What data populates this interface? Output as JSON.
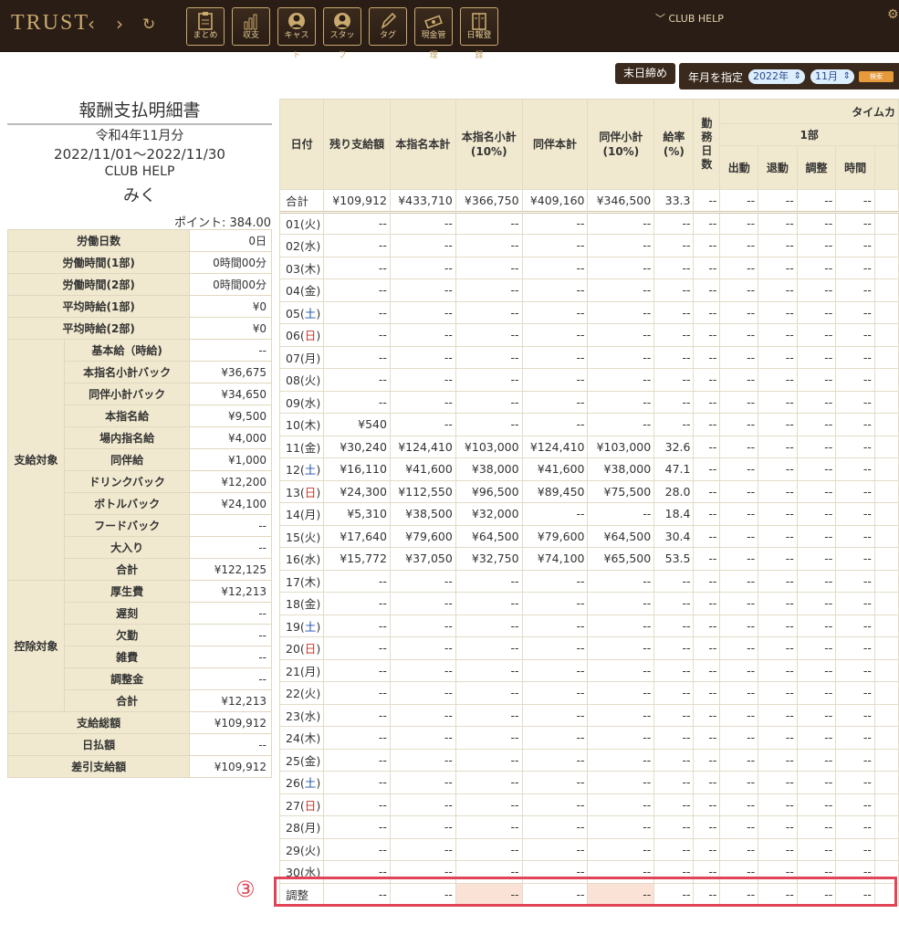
{
  "header": {
    "logo": "TRUST",
    "back": "‹",
    "forward": "›",
    "reload": "↻",
    "club": "CLUB HELP",
    "gear": "⚙",
    "tools": [
      {
        "label": "まとめ",
        "label2": ""
      },
      {
        "label": "収支",
        "label2": ""
      },
      {
        "label": "キャス",
        "label2": "ト"
      },
      {
        "label": "スタッ",
        "label2": "フ"
      },
      {
        "label": "タグ",
        "label2": ""
      },
      {
        "label": "現金管",
        "label2": "理"
      },
      {
        "label": "日報登",
        "label2": "録"
      }
    ]
  },
  "controls": {
    "end_btn": "末日締め",
    "ym_label": "年月を指定",
    "year": "2022年",
    "month": "11月",
    "search": "検索"
  },
  "slip": {
    "title": "報酬支払明細書",
    "period_jp": "令和4年11月分",
    "range": "2022/11/01〜2022/11/30",
    "club": "CLUB HELP",
    "name": "みく",
    "points": "ポイント: 384.00"
  },
  "summary": {
    "top": [
      {
        "k": "労働日数",
        "v": "0日"
      },
      {
        "k": "労働時間(1部)",
        "v": "0時間00分"
      },
      {
        "k": "労働時間(2部)",
        "v": "0時間00分"
      },
      {
        "k": "平均時給(1部)",
        "v": "¥0"
      },
      {
        "k": "平均時給(2部)",
        "v": "¥0"
      }
    ],
    "pay_group": "支給対象",
    "pay": [
      {
        "k": "基本給（時給)",
        "v": "--"
      },
      {
        "k": "本指名小計バック",
        "v": "¥36,675"
      },
      {
        "k": "同伴小計バック",
        "v": "¥34,650"
      },
      {
        "k": "本指名給",
        "v": "¥9,500"
      },
      {
        "k": "場内指名給",
        "v": "¥4,000"
      },
      {
        "k": "同伴給",
        "v": "¥1,000"
      },
      {
        "k": "ドリンクバック",
        "v": "¥12,200"
      },
      {
        "k": "ボトルバック",
        "v": "¥24,100"
      },
      {
        "k": "フードバック",
        "v": "--"
      },
      {
        "k": "大入り",
        "v": "--"
      },
      {
        "k": "合計",
        "v": "¥122,125"
      }
    ],
    "ded_group": "控除対象",
    "ded": [
      {
        "k": "厚生費",
        "v": "¥12,213"
      },
      {
        "k": "遅刻",
        "v": "--"
      },
      {
        "k": "欠勤",
        "v": "--"
      },
      {
        "k": "雑費",
        "v": "--"
      },
      {
        "k": "調整金",
        "v": "--"
      },
      {
        "k": "合計",
        "v": "¥12,213"
      }
    ],
    "bottom": [
      {
        "k": "支給総額",
        "v": "¥109,912"
      },
      {
        "k": "日払額",
        "v": "--"
      },
      {
        "k": "差引支給額",
        "v": "¥109,912"
      }
    ]
  },
  "table": {
    "headers": [
      "日付",
      "残り支給額",
      "本指名本計",
      "本指名小計\n(10%)",
      "同伴本計",
      "同伴小計\n(10%)",
      "給率\n(%)",
      "勤\n務\n日\n数"
    ],
    "timecard": "タイムカ",
    "part1": "1部",
    "sub": [
      "出動",
      "退動",
      "調整",
      "時間"
    ],
    "total": [
      "合計",
      "¥109,912",
      "¥433,710",
      "¥366,750",
      "¥409,160",
      "¥346,500",
      "33.3",
      "--",
      "--",
      "--",
      "--",
      "--",
      ""
    ],
    "rows": [
      [
        "01(火)",
        "--",
        "--",
        "--",
        "--",
        "--",
        "--",
        "--",
        "--",
        "--",
        "--",
        "--",
        ""
      ],
      [
        "02(水)",
        "--",
        "--",
        "--",
        "--",
        "--",
        "--",
        "--",
        "--",
        "--",
        "--",
        "--",
        ""
      ],
      [
        "03(木)",
        "--",
        "--",
        "--",
        "--",
        "--",
        "--",
        "--",
        "--",
        "--",
        "--",
        "--",
        ""
      ],
      [
        "04(金)",
        "--",
        "--",
        "--",
        "--",
        "--",
        "--",
        "--",
        "--",
        "--",
        "--",
        "--",
        ""
      ],
      [
        "05(土)",
        "--",
        "--",
        "--",
        "--",
        "--",
        "--",
        "--",
        "--",
        "--",
        "--",
        "--",
        ""
      ],
      [
        "06(日)",
        "--",
        "--",
        "--",
        "--",
        "--",
        "--",
        "--",
        "--",
        "--",
        "--",
        "--",
        ""
      ],
      [
        "07(月)",
        "--",
        "--",
        "--",
        "--",
        "--",
        "--",
        "--",
        "--",
        "--",
        "--",
        "--",
        ""
      ],
      [
        "08(火)",
        "--",
        "--",
        "--",
        "--",
        "--",
        "--",
        "--",
        "--",
        "--",
        "--",
        "--",
        ""
      ],
      [
        "09(水)",
        "--",
        "--",
        "--",
        "--",
        "--",
        "--",
        "--",
        "--",
        "--",
        "--",
        "--",
        ""
      ],
      [
        "10(木)",
        "¥540",
        "--",
        "--",
        "--",
        "--",
        "--",
        "--",
        "--",
        "--",
        "--",
        "--",
        ""
      ],
      [
        "11(金)",
        "¥30,240",
        "¥124,410",
        "¥103,000",
        "¥124,410",
        "¥103,000",
        "32.6",
        "--",
        "--",
        "--",
        "--",
        "--",
        ""
      ],
      [
        "12(土)",
        "¥16,110",
        "¥41,600",
        "¥38,000",
        "¥41,600",
        "¥38,000",
        "47.1",
        "--",
        "--",
        "--",
        "--",
        "--",
        ""
      ],
      [
        "13(日)",
        "¥24,300",
        "¥112,550",
        "¥96,500",
        "¥89,450",
        "¥75,500",
        "28.0",
        "--",
        "--",
        "--",
        "--",
        "--",
        ""
      ],
      [
        "14(月)",
        "¥5,310",
        "¥38,500",
        "¥32,000",
        "--",
        "--",
        "18.4",
        "--",
        "--",
        "--",
        "--",
        "--",
        ""
      ],
      [
        "15(火)",
        "¥17,640",
        "¥79,600",
        "¥64,500",
        "¥79,600",
        "¥64,500",
        "30.4",
        "--",
        "--",
        "--",
        "--",
        "--",
        ""
      ],
      [
        "16(水)",
        "¥15,772",
        "¥37,050",
        "¥32,750",
        "¥74,100",
        "¥65,500",
        "53.5",
        "--",
        "--",
        "--",
        "--",
        "--",
        ""
      ],
      [
        "17(木)",
        "--",
        "--",
        "--",
        "--",
        "--",
        "--",
        "--",
        "--",
        "--",
        "--",
        "--",
        ""
      ],
      [
        "18(金)",
        "--",
        "--",
        "--",
        "--",
        "--",
        "--",
        "--",
        "--",
        "--",
        "--",
        "--",
        ""
      ],
      [
        "19(土)",
        "--",
        "--",
        "--",
        "--",
        "--",
        "--",
        "--",
        "--",
        "--",
        "--",
        "--",
        ""
      ],
      [
        "20(日)",
        "--",
        "--",
        "--",
        "--",
        "--",
        "--",
        "--",
        "--",
        "--",
        "--",
        "--",
        ""
      ],
      [
        "21(月)",
        "--",
        "--",
        "--",
        "--",
        "--",
        "--",
        "--",
        "--",
        "--",
        "--",
        "--",
        ""
      ],
      [
        "22(火)",
        "--",
        "--",
        "--",
        "--",
        "--",
        "--",
        "--",
        "--",
        "--",
        "--",
        "--",
        ""
      ],
      [
        "23(水)",
        "--",
        "--",
        "--",
        "--",
        "--",
        "--",
        "--",
        "--",
        "--",
        "--",
        "--",
        ""
      ],
      [
        "24(木)",
        "--",
        "--",
        "--",
        "--",
        "--",
        "--",
        "--",
        "--",
        "--",
        "--",
        "--",
        ""
      ],
      [
        "25(金)",
        "--",
        "--",
        "--",
        "--",
        "--",
        "--",
        "--",
        "--",
        "--",
        "--",
        "--",
        ""
      ],
      [
        "26(土)",
        "--",
        "--",
        "--",
        "--",
        "--",
        "--",
        "--",
        "--",
        "--",
        "--",
        "--",
        ""
      ],
      [
        "27(日)",
        "--",
        "--",
        "--",
        "--",
        "--",
        "--",
        "--",
        "--",
        "--",
        "--",
        "--",
        ""
      ],
      [
        "28(月)",
        "--",
        "--",
        "--",
        "--",
        "--",
        "--",
        "--",
        "--",
        "--",
        "--",
        "--",
        ""
      ],
      [
        "29(火)",
        "--",
        "--",
        "--",
        "--",
        "--",
        "--",
        "--",
        "--",
        "--",
        "--",
        "--",
        ""
      ],
      [
        "30(水)",
        "--",
        "--",
        "--",
        "--",
        "--",
        "--",
        "--",
        "--",
        "--",
        "--",
        "--",
        ""
      ]
    ],
    "adjust": [
      "調整",
      "--",
      "--",
      "--",
      "--",
      "--",
      "--",
      "--",
      "--",
      "--",
      "--",
      "--",
      ""
    ]
  },
  "annotation": {
    "marker": "③",
    "color": "#e04456"
  }
}
